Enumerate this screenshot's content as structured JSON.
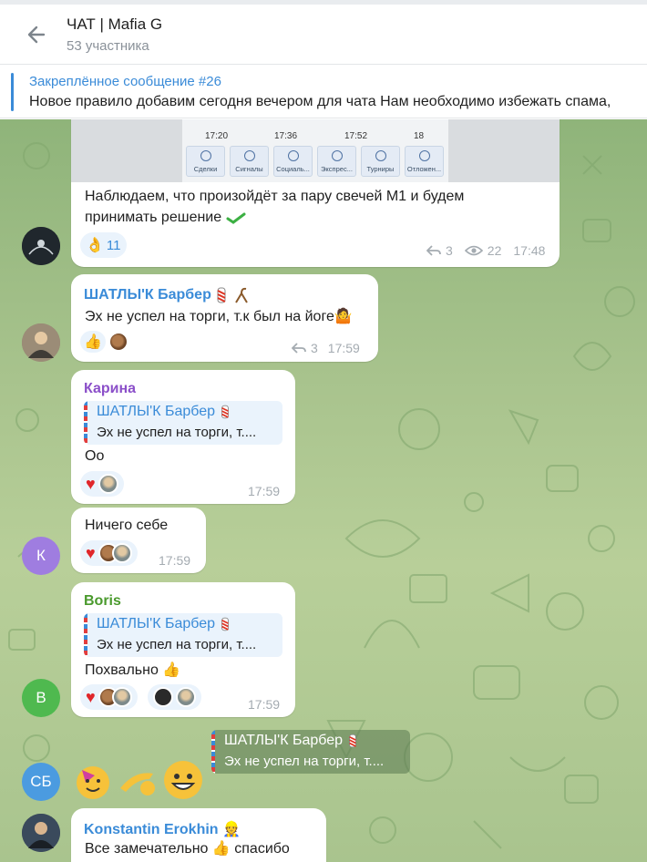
{
  "header": {
    "title": "ЧАТ | Mafia G",
    "subtitle": "53 участника"
  },
  "pinned": {
    "title": "Закреплённое сообщение #26",
    "text": "Новое правило добавим сегодня вечером для чата Нам необходимо избежать спама,"
  },
  "screenshot": {
    "ticks": [
      "17:20",
      "17:36",
      "17:52",
      "18"
    ],
    "tabs": [
      "Сделки",
      "Сигналы",
      "Социаль...",
      "Экспрес...",
      "Турниры",
      "Отложен..."
    ]
  },
  "messages": [
    {
      "text_line1": "Наблюдаем, что произойдёт за пару свечей М1 и будем",
      "text_line2": "принимать решение",
      "reaction_count": "11",
      "replies": "3",
      "views": "22",
      "time": "17:48"
    },
    {
      "author": "ШАТЛЫ'К Барбер",
      "text": "Эх не успел на торги, т.к был на йоге",
      "replies": "3",
      "time": "17:59"
    },
    {
      "author": "Карина",
      "reply_author": "ШАТЛЫ'К Барбер",
      "reply_text": "Эх не успел на торги, т....",
      "text": "Оо",
      "time": "17:59"
    },
    {
      "text": "Ничего себе",
      "time": "17:59",
      "avatar_initials": "К"
    },
    {
      "author": "Boris",
      "reply_author": "ШАТЛЫ'К Барбер",
      "reply_text": "Эх не успел на торги, т....",
      "text": "Похвально",
      "time": "17:59",
      "avatar_initials": "B"
    },
    {
      "reply_author": "ШАТЛЫ'К Барбер",
      "reply_text": "Эх не успел на торги, т....",
      "avatar_initials": "СБ"
    },
    {
      "author": "Konstantin Erokhin",
      "text_before": "Все замечательно",
      "text_after": "спасибо"
    }
  ],
  "colors": {
    "accent": "#3a8bd8",
    "karina": "#8b4fc9",
    "boris": "#4a9a2d",
    "avatar_k": "#9f7de0",
    "avatar_b": "#4fb94f",
    "avatar_sb": "#4b9be0"
  }
}
